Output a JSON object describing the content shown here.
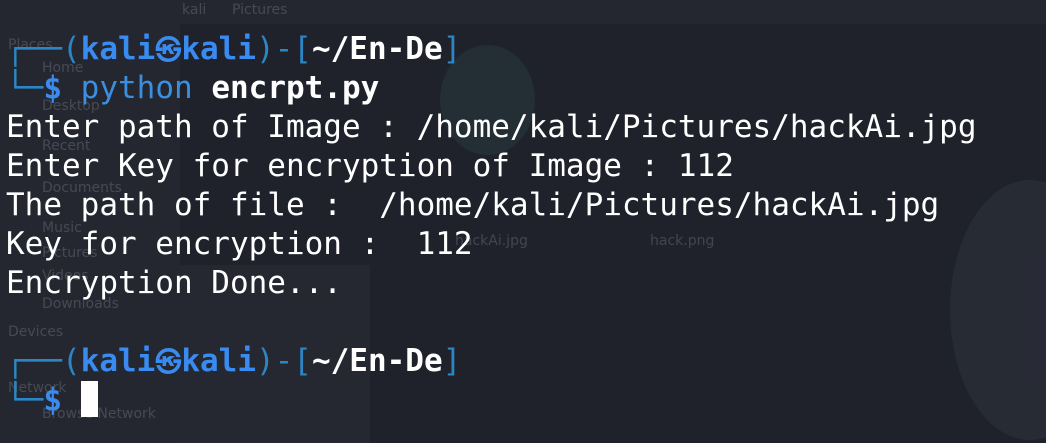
{
  "prompt": {
    "open_paren": "┌──(",
    "user": "kali",
    "at_symbol": "㉿",
    "host": "kali",
    "close_paren": ")-[",
    "cwd": "~/En-De",
    "close_bracket": "]",
    "corner": "└─",
    "dollar": "$"
  },
  "command": {
    "program": "python",
    "argument": "encrpt.py"
  },
  "output": [
    "Enter path of Image : /home/kali/Pictures/hackAi.jpg",
    "Enter Key for encryption of Image : 112",
    "The path of file :  /home/kali/Pictures/hackAi.jpg",
    "Key for encryption :  112",
    "Encryption Done..."
  ],
  "background": {
    "breadcrumb": [
      "kali",
      "Pictures"
    ],
    "sidebar_items": [
      "Places",
      "Home",
      "Desktop",
      "Recent",
      "Documents",
      "Music",
      "Pictures",
      "Videos",
      "Downloads",
      "Devices",
      "Network",
      "Browse Network"
    ],
    "files": [
      "hackAi.jpg",
      "hack.png"
    ]
  },
  "colors": {
    "background": "#1f222b",
    "prompt_blue": "#3a8bf0",
    "frame_blue": "#2c86c6",
    "text": "#ffffff"
  }
}
